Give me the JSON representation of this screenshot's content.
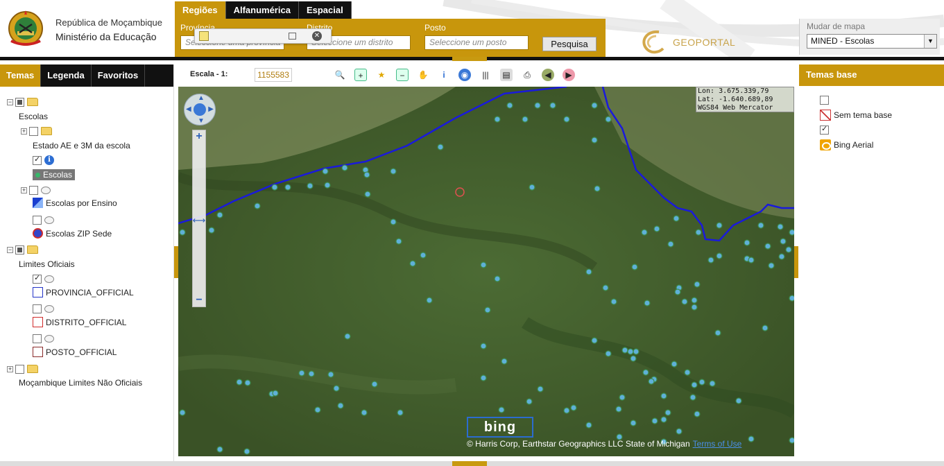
{
  "header": {
    "gov_line1": "República de Moçambique",
    "gov_line2": "Ministério da Educação",
    "brand": "GEOPORTAL"
  },
  "search": {
    "tabs": [
      {
        "label": "Regiões",
        "active": true
      },
      {
        "label": "Alfanumérica",
        "active": false
      },
      {
        "label": "Espacial",
        "active": false
      }
    ],
    "fields": [
      {
        "label": "Província",
        "placeholder": "Seleccione uma província"
      },
      {
        "label": "Distrito",
        "placeholder": "Seleccione um distrito"
      },
      {
        "label": "Posto",
        "placeholder": "Seleccione um posto"
      }
    ],
    "button": "Pesquisa"
  },
  "map_switch": {
    "label": "Mudar de mapa",
    "selected": "MINED - Escolas"
  },
  "left_panel": {
    "tabs": [
      {
        "label": "Temas",
        "active": true
      },
      {
        "label": "Legenda",
        "active": false
      },
      {
        "label": "Favoritos",
        "active": false
      }
    ],
    "tree": {
      "escolas_group": "Escolas",
      "estado_group": "Estado AE e 3M da escola",
      "escolas_layer": "Escolas",
      "escolas_ensino": "Escolas por Ensino",
      "escolas_zip": "Escolas ZIP Sede",
      "limites_group": "Limites Oficiais",
      "provincia": "PROVINCIA_OFFICIAL",
      "distrito": "DISTRITO_OFFICIAL",
      "posto": "POSTO_OFFICIAL",
      "nao_oficiais": "Moçambique Limites Não Oficiais"
    }
  },
  "map": {
    "scale_label": "Escala - 1:",
    "scale_value": "1155583",
    "coords": {
      "lon": "Lon: 3.675.339,79",
      "lat": "Lat: -1.640.689,89",
      "crs": "WGS84 Web Mercator"
    },
    "bing_logo": "bing",
    "copyright": "© Harris Corp, Earthstar Geographics LLC State of Michigan",
    "terms": "Terms of Use"
  },
  "right_panel": {
    "title": "Temas base",
    "items": [
      {
        "label": "Sem tema base",
        "checked": false
      },
      {
        "label": "Bing Aerial",
        "checked": true
      }
    ]
  },
  "colors": {
    "accent": "#c8960c",
    "dark": "#111111",
    "boundary": "#1a1adb",
    "school_point": "#5fb0d8"
  }
}
